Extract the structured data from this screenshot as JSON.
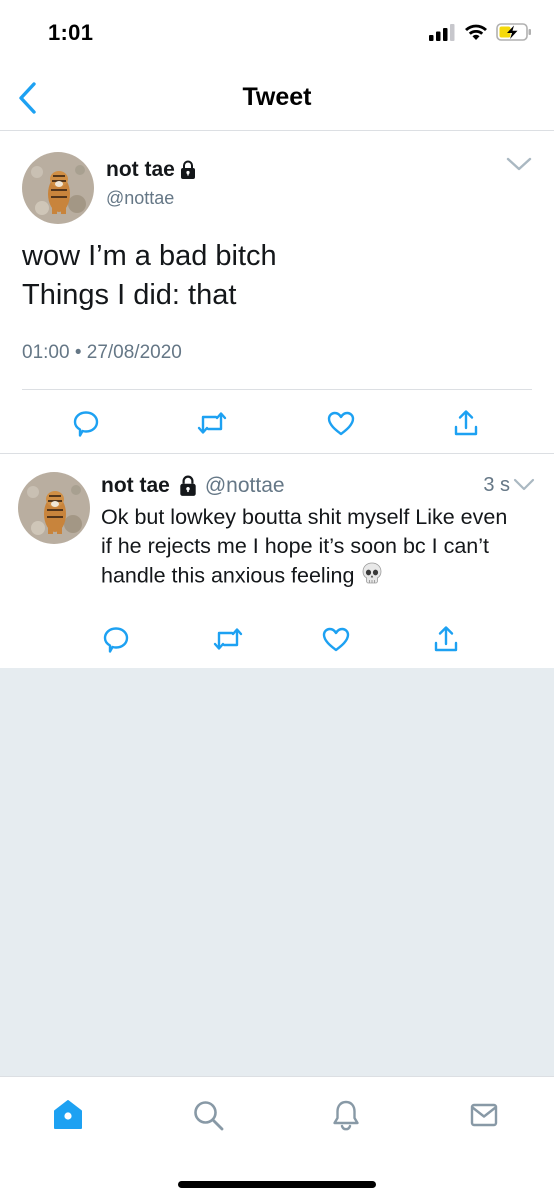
{
  "status_bar": {
    "time": "1:01"
  },
  "nav": {
    "title": "Tweet"
  },
  "main_tweet": {
    "display_name": "not tae",
    "handle": "@nottae",
    "text_line1": "wow I’m a bad bitch",
    "text_line2": "Things I did: that",
    "timestamp": "01:00 • 27/08/2020"
  },
  "reply": {
    "display_name": "not tae",
    "handle": "@nottae",
    "age": "3 s",
    "text": "Ok but lowkey boutta shit myself Like even if he rejects me I hope it’s soon bc I can’t handle this anxious feeling"
  },
  "icons": {
    "back": "chevron-left-icon",
    "lock": "lock-icon",
    "more": "chevron-down-icon",
    "reply": "reply-bubble-icon",
    "retweet": "retweet-icon",
    "like": "heart-icon",
    "share": "share-upload-icon",
    "skull": "skull-emoji",
    "home": "home-icon",
    "search": "search-icon",
    "notifications": "bell-icon",
    "messages": "envelope-icon"
  },
  "colors": {
    "accent": "#1da1f2",
    "text": "#14171a",
    "secondary_text": "#657786",
    "icon_grey": "#8899a6",
    "background_empty": "#e6ecf0",
    "divider": "#dcdfe3"
  }
}
